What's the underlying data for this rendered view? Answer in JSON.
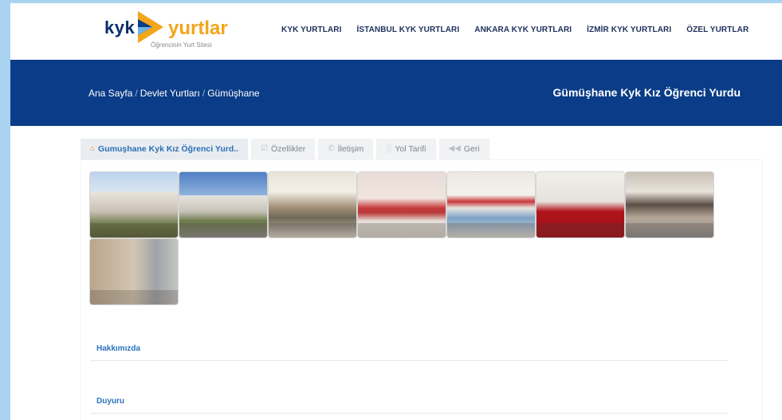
{
  "logo": {
    "kyk": "kyk",
    "yurtlar": "yurtlar",
    "tagline": "Öğrencinin Yurt Sitesi"
  },
  "nav": {
    "items": [
      "KYK YURTLARI",
      "İSTANBUL KYK YURTLARI",
      "ANKARA KYK YURTLARI",
      "İZMİR KYK YURTLARI",
      "ÖZEL YURTLAR"
    ]
  },
  "breadcrumb": {
    "items": [
      "Ana Sayfa",
      "Devlet Yurtları",
      "Gümüşhane"
    ],
    "separator": "/"
  },
  "banner": {
    "title": "Gümüşhane Kyk Kız Öğrenci Yurdu",
    "color": "#0a3c87"
  },
  "tabs": [
    {
      "label": "Gumuşhane Kyk Kız Öğrenci Yurd..",
      "icon": "home-icon",
      "active": true
    },
    {
      "label": "Özellikler",
      "icon": "checkbox-icon",
      "active": false
    },
    {
      "label": "İletişim",
      "icon": "phone-icon",
      "active": false
    },
    {
      "label": "Yol Tarifi",
      "icon": "road-icon",
      "active": false
    },
    {
      "label": "Geri",
      "icon": "back-icon",
      "active": false
    }
  ],
  "gallery": {
    "photos": [
      "building-exterior",
      "building-exterior",
      "dining-hall",
      "common-room",
      "dining-hall",
      "dorm-hallway",
      "dorm-room",
      "dorm-room"
    ]
  },
  "sections": {
    "about": "Hakkımızda",
    "announcement": "Duyuru"
  }
}
